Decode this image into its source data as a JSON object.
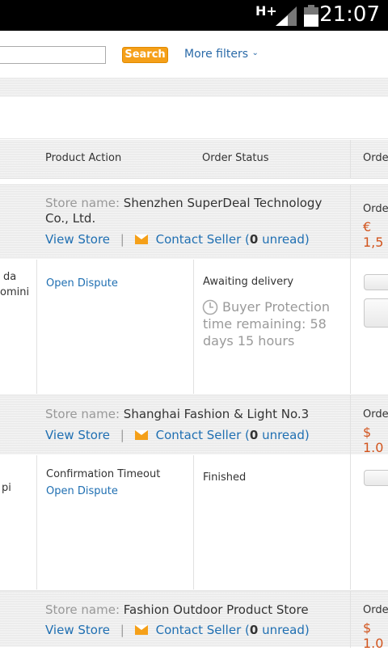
{
  "status_bar": {
    "network": "H+",
    "time": "21:07"
  },
  "search": {
    "button_label": "Search",
    "more_filters_label": "More filters",
    "input_value": ""
  },
  "table_header": {
    "product_action": "Product Action",
    "order_status": "Order Status",
    "order_partial": "Orde"
  },
  "stores": [
    {
      "store_label": "Store name:",
      "store_name": "Shenzhen SuperDeal Technology Co., Ltd.",
      "view_store": "View Store",
      "separator": "|",
      "contact_seller": "Contact Seller (",
      "unread_count": "0",
      "unread_suffix": " unread)",
      "order_label": "Orde",
      "price": "€ 1,5"
    },
    {
      "store_label": "Store name:",
      "store_name": "Shanghai Fashion & Light No.3",
      "view_store": "View Store",
      "separator": "|",
      "contact_seller": "Contact Seller (",
      "unread_count": "0",
      "unread_suffix": " unread)",
      "order_label": "Orde",
      "price": "$ 1.0"
    },
    {
      "store_label": "Store name:",
      "store_name": "Fashion Outdoor Product Store",
      "view_store": "View Store",
      "separator": "|",
      "contact_seller": "Contact Seller (",
      "unread_count": "0",
      "unread_suffix": " unread)",
      "order_label": "Orde",
      "price": "$ 1.0"
    }
  ],
  "orders": [
    {
      "product_fragment_1": "da",
      "product_fragment_2": "omini",
      "action_1": "Open Dispute",
      "status": "Awaiting delivery",
      "protection": "Buyer Protection time remaining: 58 days 15 hours"
    },
    {
      "product_fragment_1": "pi",
      "action_1": "Confirmation Timeout",
      "action_2": "Open Dispute",
      "status": "Finished"
    }
  ],
  "colors": {
    "accent_orange": "#f5a019",
    "link_blue": "#1f6fb2",
    "price_red": "#d2541d"
  }
}
